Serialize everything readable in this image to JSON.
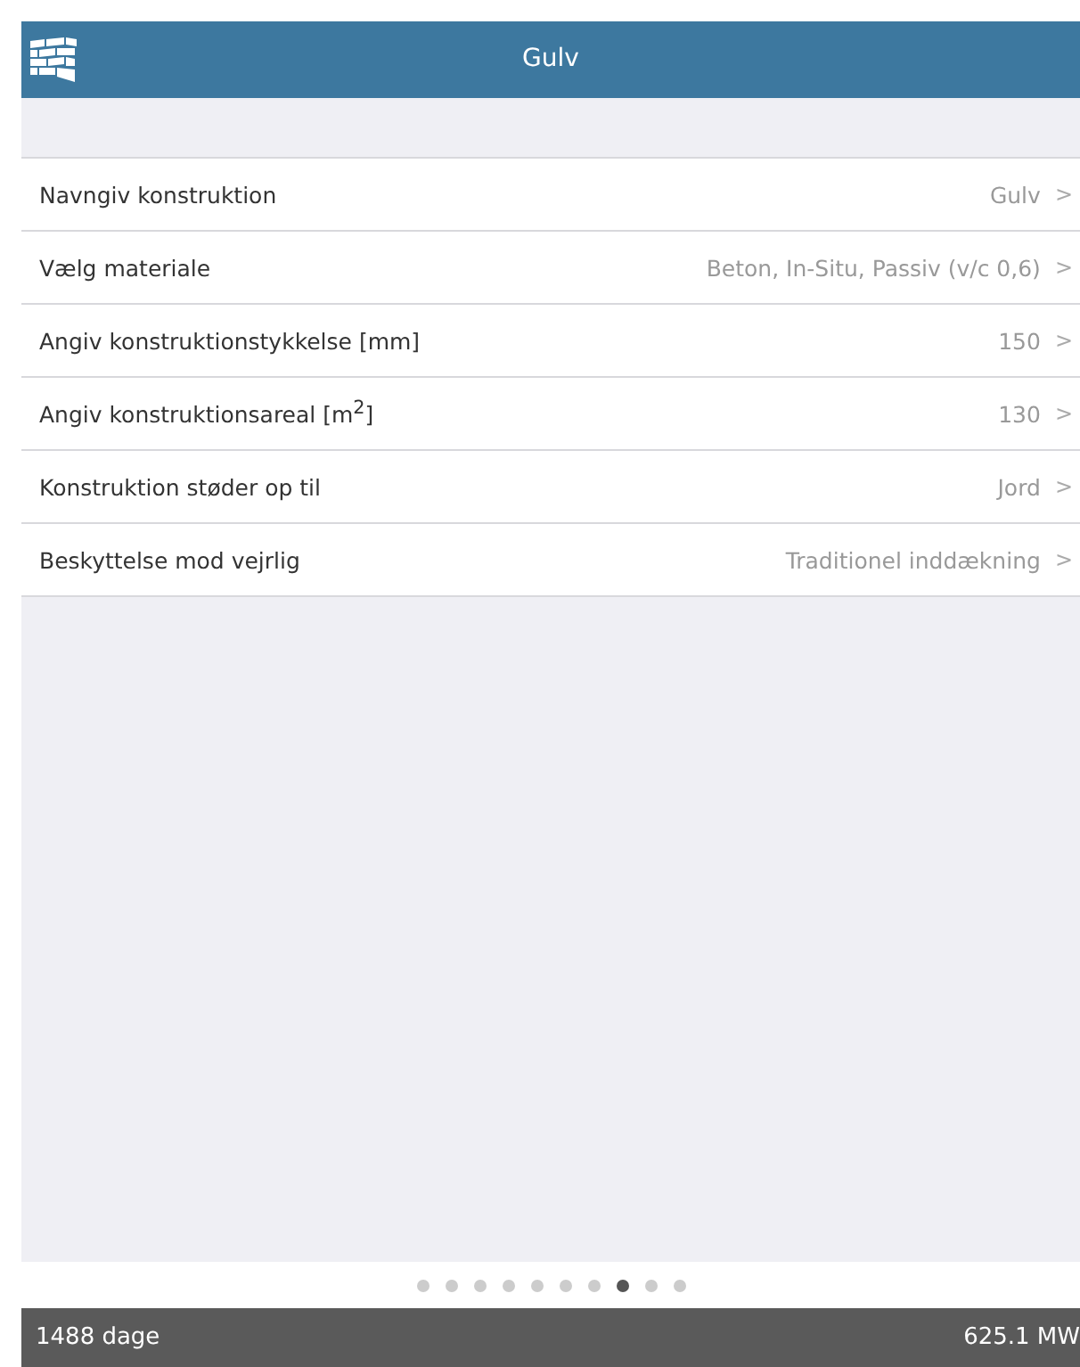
{
  "header": {
    "title": "Gulv"
  },
  "rows": [
    {
      "label": "Navngiv konstruktion",
      "value": "Gulv",
      "chevron": ">"
    },
    {
      "label": "Vælg materiale",
      "value": "Beton, In-Situ, Passiv (v/c 0,6)",
      "chevron": ">"
    },
    {
      "label": "Angiv konstruktionstykkelse [mm]",
      "value": "150",
      "chevron": ">"
    },
    {
      "label": "Angiv konstruktionsareal [m$^{2}$]",
      "value": "130",
      "chevron": ">"
    },
    {
      "label": "Konstruktion støder op til",
      "value": "Jord",
      "chevron": ">"
    },
    {
      "label": "Beskyttelse mod vejrlig",
      "value": "Traditionel inddækning",
      "chevron": ">"
    }
  ],
  "pager": [
    {
      "selected": false
    },
    {
      "selected": false
    },
    {
      "selected": false
    },
    {
      "selected": false
    },
    {
      "selected": false
    },
    {
      "selected": false
    },
    {
      "selected": false
    },
    {
      "selected": true
    },
    {
      "selected": false
    },
    {
      "selected": false
    }
  ],
  "status_bar": {
    "left": "1488 dage",
    "right": "625.1 MW"
  }
}
